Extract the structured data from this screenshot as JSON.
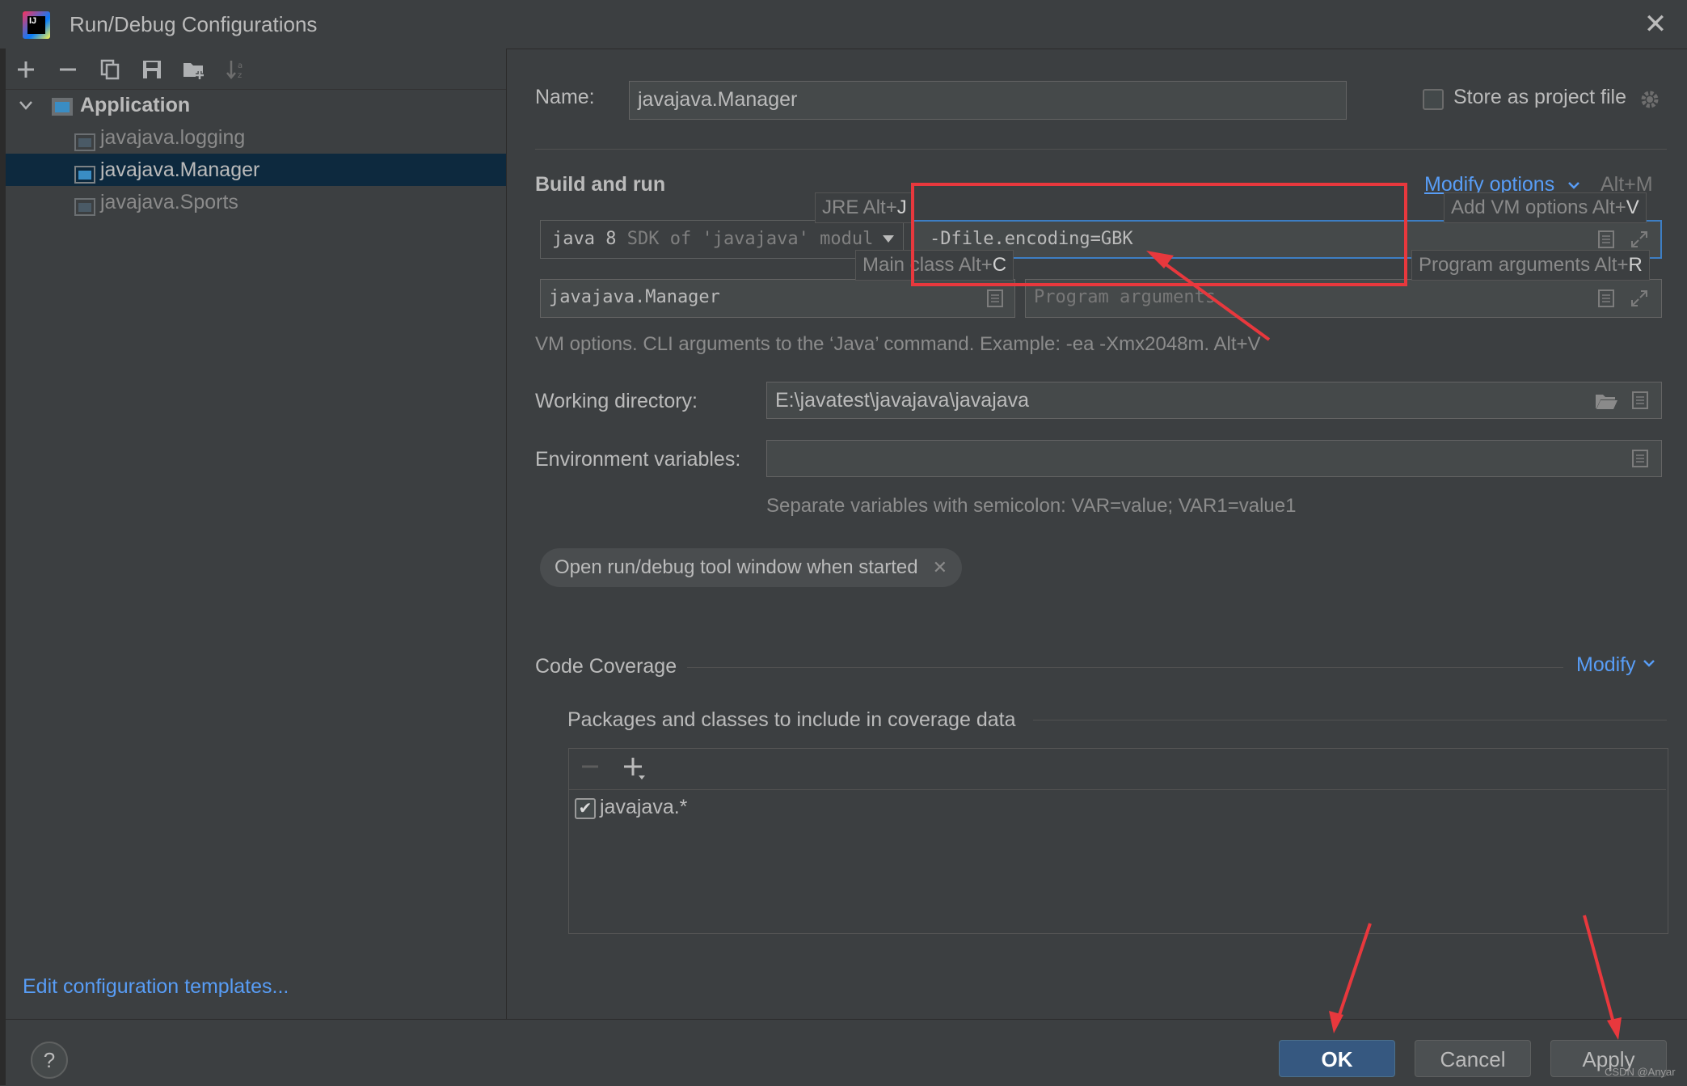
{
  "window": {
    "title": "Run/Debug Configurations",
    "logo_text": "IJ",
    "close_glyph": "✕"
  },
  "toolbar": {
    "icons": [
      "add-icon",
      "remove-icon",
      "copy-icon",
      "save-icon",
      "new-folder-icon",
      "sort-icon"
    ]
  },
  "tree": {
    "group_label": "Application",
    "items": [
      {
        "label": "javajava.logging",
        "selected": false
      },
      {
        "label": "javajava.Manager",
        "selected": true
      },
      {
        "label": "javajava.Sports",
        "selected": false
      }
    ]
  },
  "sidebar": {
    "edit_templates": "Edit configuration templates..."
  },
  "form": {
    "name_label": "Name:",
    "name_value": "javajava.Manager",
    "store_label": "Store as project file",
    "store_checked": false,
    "build_run_title": "Build and run",
    "modify_options": "Modify options",
    "modify_options_shortcut": "Alt+M",
    "jre_main": "java 8",
    "jre_sub": "SDK of 'javajava' modul",
    "vm_options_value": "-Dfile.encoding=GBK",
    "main_class_value": "javajava.Manager",
    "program_args_placeholder": "Program arguments",
    "hints": {
      "jre": "JRE Alt+",
      "jre_key": "J",
      "main": "Main class Alt+",
      "main_key": "C",
      "add_vm": "Add VM options Alt+",
      "add_vm_key": "V",
      "prog_args": "Program arguments Alt+",
      "prog_args_key": "R"
    },
    "vm_help": "VM options. CLI arguments to the ‘Java’ command. Example: -ea -Xmx2048m. Alt+V",
    "workdir_label": "Working directory:",
    "workdir_value": "E:\\javatest\\javajava\\javajava",
    "env_label": "Environment variables:",
    "env_value": "",
    "env_help": "Separate variables with semicolon: VAR=value; VAR1=value1",
    "tag_chip": "Open run/debug tool window when started",
    "coverage_title": "Code Coverage",
    "coverage_modify": "Modify",
    "packages_title": "Packages and classes to include in coverage data",
    "packages": [
      {
        "name": "javajava.*",
        "checked": true
      }
    ]
  },
  "buttons": {
    "help": "?",
    "ok": "OK",
    "cancel": "Cancel",
    "apply": "Apply"
  },
  "watermark": "CSDN @Anyar",
  "colors": {
    "accent_link": "#589df6",
    "selection": "#0d293e",
    "ok_button": "#365880",
    "annotation_red": "#e8383d"
  }
}
